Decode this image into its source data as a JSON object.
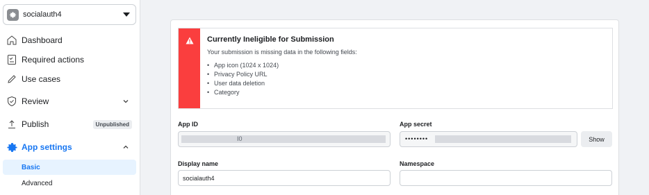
{
  "app": {
    "name": "socialauth4"
  },
  "sidebar": {
    "items": [
      {
        "label": "Dashboard"
      },
      {
        "label": "Required actions"
      },
      {
        "label": "Use cases"
      },
      {
        "label": "Review"
      },
      {
        "label": "Publish",
        "badge": "Unpublished"
      },
      {
        "label": "App settings"
      }
    ],
    "sub_items": [
      {
        "label": "Basic"
      },
      {
        "label": "Advanced"
      }
    ]
  },
  "alert": {
    "title": "Currently Ineligible for Submission",
    "description": "Your submission is missing data in the following fields:",
    "missing": [
      "App icon (1024 x 1024)",
      "Privacy Policy URL",
      "User data deletion",
      "Category"
    ]
  },
  "form": {
    "app_id_label": "App ID",
    "app_id_value": "I0",
    "app_secret_label": "App secret",
    "app_secret_value": "••••••••",
    "show_label": "Show",
    "display_name_label": "Display name",
    "display_name_value": "socialauth4",
    "namespace_label": "Namespace",
    "namespace_value": ""
  },
  "colors": {
    "accent": "#1877f2",
    "alert": "#fa3e3e"
  }
}
